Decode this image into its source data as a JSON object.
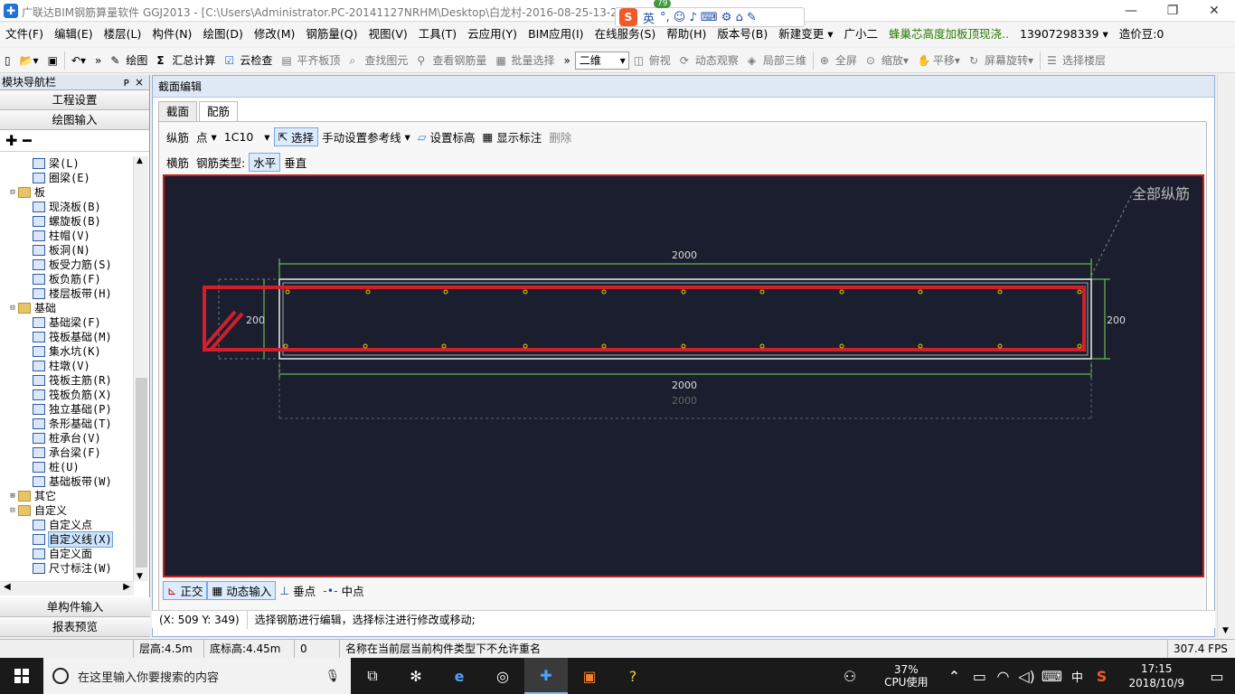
{
  "titlebar": {
    "title": "广联达BIM钢筋算量软件 GGJ2013 - [C:\\Users\\Administrator.PC-20141127NRHM\\Desktop\\白龙村-2016-08-25-13-27"
  },
  "ime": {
    "logo": "S",
    "lang": "英",
    "badge": "79",
    "symbols": "°, ☺ ♪ ⌨ ⚙ ⌂ ✎"
  },
  "window_controls": {
    "minimize": "—",
    "restore": "❐",
    "close": "✕"
  },
  "menu": [
    "文件(F)",
    "编辑(E)",
    "楼层(L)",
    "构件(N)",
    "绘图(D)",
    "修改(M)",
    "钢筋量(Q)",
    "视图(V)",
    "工具(T)",
    "云应用(Y)",
    "BIM应用(I)",
    "在线服务(S)",
    "帮助(H)",
    "版本号(B)",
    "新建变更 ▾",
    "广小二",
    "蜂巢芯高度加板顶现浇..",
    "13907298339 ▾",
    "造价豆:0"
  ],
  "toolbar": {
    "draw": "绘图",
    "sum": "汇总计算",
    "cloud_check": "云检查",
    "level_top": "平齐板顶",
    "find": "查找图元",
    "view_rebar": "查看钢筋量",
    "batch": "批量选择",
    "view_mode": "二维",
    "plan": "俯视",
    "dynamic": "动态观察",
    "local3d": "局部三维",
    "fullscreen": "全屏",
    "zoom": "缩放",
    "pan": "平移",
    "rotate": "屏幕旋转",
    "select_floor": "选择楼层"
  },
  "nav": {
    "header": "模块导航栏",
    "pin": "ᴘ",
    "close": "×",
    "top_buttons": [
      "工程设置",
      "绘图输入"
    ],
    "bottom_buttons": [
      "单构件输入",
      "报表预览"
    ],
    "tree": [
      {
        "t": "",
        "label": "梁(L)",
        "lvl": 2,
        "kind": "leaf"
      },
      {
        "t": "",
        "label": "圈梁(E)",
        "lvl": 2,
        "kind": "leaf"
      },
      {
        "t": "⊟",
        "label": "板",
        "lvl": 1,
        "kind": "folder"
      },
      {
        "t": "",
        "label": "现浇板(B)",
        "lvl": 2,
        "kind": "leaf"
      },
      {
        "t": "",
        "label": "螺旋板(B)",
        "lvl": 2,
        "kind": "leaf"
      },
      {
        "t": "",
        "label": "柱帽(V)",
        "lvl": 2,
        "kind": "leaf"
      },
      {
        "t": "",
        "label": "板洞(N)",
        "lvl": 2,
        "kind": "leaf"
      },
      {
        "t": "",
        "label": "板受力筋(S)",
        "lvl": 2,
        "kind": "leaf"
      },
      {
        "t": "",
        "label": "板负筋(F)",
        "lvl": 2,
        "kind": "leaf"
      },
      {
        "t": "",
        "label": "楼层板带(H)",
        "lvl": 2,
        "kind": "leaf"
      },
      {
        "t": "⊟",
        "label": "基础",
        "lvl": 1,
        "kind": "folder"
      },
      {
        "t": "",
        "label": "基础梁(F)",
        "lvl": 2,
        "kind": "leaf"
      },
      {
        "t": "",
        "label": "筏板基础(M)",
        "lvl": 2,
        "kind": "leaf"
      },
      {
        "t": "",
        "label": "集水坑(K)",
        "lvl": 2,
        "kind": "leaf"
      },
      {
        "t": "",
        "label": "柱墩(V)",
        "lvl": 2,
        "kind": "leaf"
      },
      {
        "t": "",
        "label": "筏板主筋(R)",
        "lvl": 2,
        "kind": "leaf"
      },
      {
        "t": "",
        "label": "筏板负筋(X)",
        "lvl": 2,
        "kind": "leaf"
      },
      {
        "t": "",
        "label": "独立基础(P)",
        "lvl": 2,
        "kind": "leaf"
      },
      {
        "t": "",
        "label": "条形基础(T)",
        "lvl": 2,
        "kind": "leaf"
      },
      {
        "t": "",
        "label": "桩承台(V)",
        "lvl": 2,
        "kind": "leaf"
      },
      {
        "t": "",
        "label": "承台梁(F)",
        "lvl": 2,
        "kind": "leaf"
      },
      {
        "t": "",
        "label": "桩(U)",
        "lvl": 2,
        "kind": "leaf"
      },
      {
        "t": "",
        "label": "基础板带(W)",
        "lvl": 2,
        "kind": "leaf"
      },
      {
        "t": "⊞",
        "label": "其它",
        "lvl": 1,
        "kind": "folder"
      },
      {
        "t": "⊟",
        "label": "自定义",
        "lvl": 1,
        "kind": "folder"
      },
      {
        "t": "",
        "label": "自定义点",
        "lvl": 2,
        "kind": "leaf"
      },
      {
        "t": "",
        "label": "自定义线(X)",
        "lvl": 2,
        "kind": "leaf",
        "selected": true
      },
      {
        "t": "",
        "label": "自定义面",
        "lvl": 2,
        "kind": "leaf"
      },
      {
        "t": "",
        "label": "尺寸标注(W)",
        "lvl": 2,
        "kind": "leaf"
      }
    ]
  },
  "editor": {
    "header": "截面编辑",
    "tabs": [
      "截面",
      "配筋"
    ],
    "row1": {
      "longitudinal": "纵筋",
      "point": "点",
      "spec": "1C10",
      "select": "选择",
      "ref_line": "手动设置参考线",
      "set_elev": "设置标高",
      "show_anno": "显示标注",
      "delete": "删除"
    },
    "row2": {
      "transverse": "横筋",
      "type_label": "钢筋类型:",
      "horizontal": "水平",
      "vertical": "垂直"
    },
    "row3": {
      "ortho": "正交",
      "dynamic_input": "动态输入",
      "perp": "垂点",
      "mid": "中点"
    },
    "canvas": {
      "corner_label": "全部纵筋",
      "dim_top": "2000",
      "dim_bottom": "2000",
      "dim_bottom2": "2000",
      "dim_left": "200",
      "dim_right": "200"
    }
  },
  "status": {
    "coords": "(X: 509 Y: 349)",
    "message": "选择钢筋进行编辑，选择标注进行修改或移动;"
  },
  "bottombar": {
    "floor_h": "层高:4.5m",
    "base_h": "底标高:4.45m",
    "zero": "0",
    "msg": "名称在当前层当前构件类型下不允许重名",
    "fps": "307.4 FPS"
  },
  "taskbar": {
    "search": "在这里输入你要搜索的内容",
    "cpu_pct": "37%",
    "cpu_label": "CPU使用",
    "ime": "中",
    "time": "17:15",
    "date": "2018/10/9"
  },
  "colors": {
    "canvas_bg": "#1b1e2e",
    "rebar_red": "#d0202a",
    "dim_green": "#7ed957",
    "rebar_dot": "#e6d400"
  }
}
